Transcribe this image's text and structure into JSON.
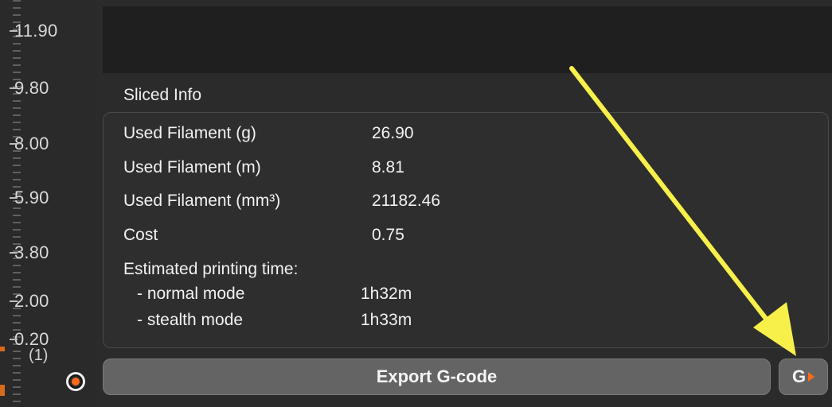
{
  "ruler": {
    "ticks": [
      "11.90",
      "9.80",
      "8.00",
      "5.90",
      "3.80",
      "2.00",
      "0.20"
    ],
    "sub_label": "(1)"
  },
  "sliced_info": {
    "title": "Sliced Info",
    "rows": [
      {
        "label": "Used Filament (g)",
        "value": "26.90"
      },
      {
        "label": "Used Filament (m)",
        "value": "8.81"
      },
      {
        "label": "Used Filament (mm³)",
        "value": "21182.46"
      },
      {
        "label": "Cost",
        "value": "0.75"
      }
    ],
    "time_heading": "Estimated printing time:",
    "modes": [
      {
        "label": "- normal mode",
        "value": "1h32m"
      },
      {
        "label": "- stealth mode",
        "value": "1h33m"
      }
    ]
  },
  "actions": {
    "export_label": "Export G-code",
    "g_label": "G"
  },
  "icons": {
    "settings": "gear-icon",
    "send": "play-triangle-icon",
    "annotation": "arrow-icon"
  },
  "colors": {
    "accent": "#ff6a1a",
    "annotation_arrow": "#f7f04a"
  }
}
